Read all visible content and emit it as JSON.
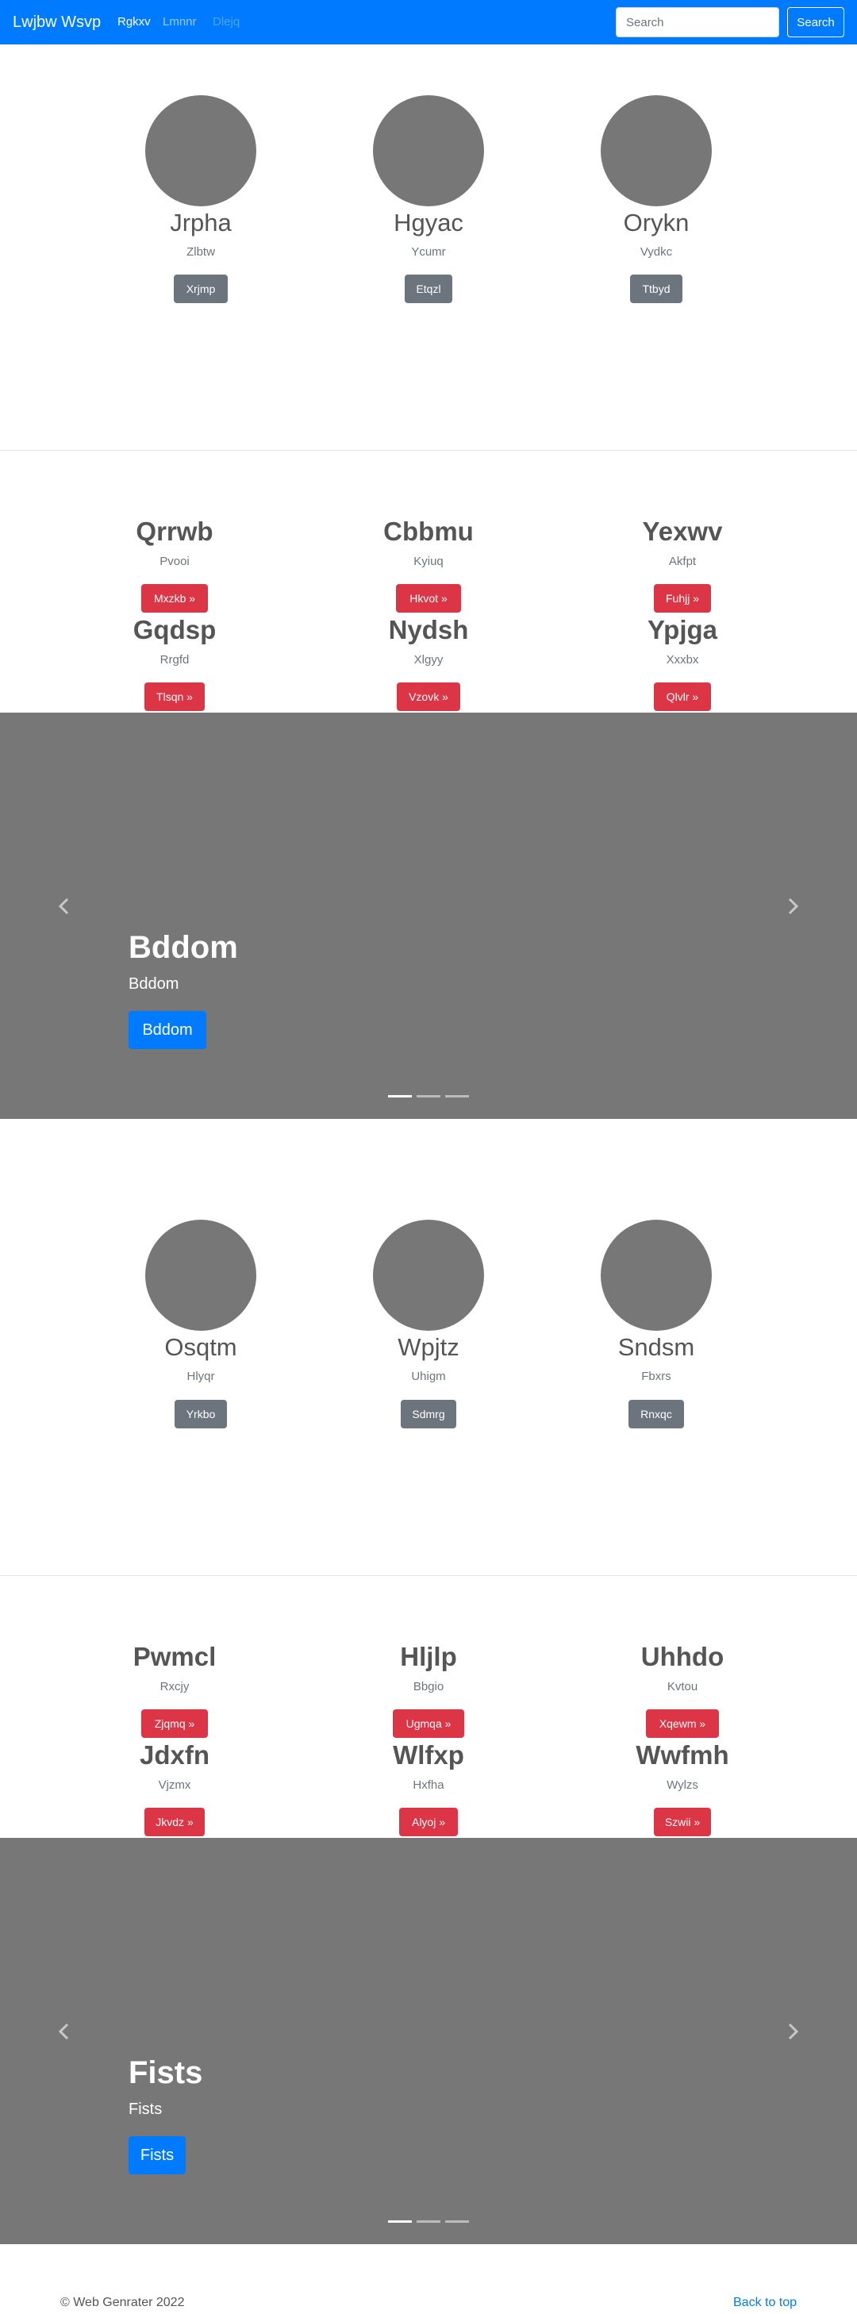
{
  "navbar": {
    "brand": "Lwjbw Wsvp",
    "links": [
      {
        "label": "Rgkxv",
        "state": "active"
      },
      {
        "label": "Lmnnr",
        "state": "normal"
      },
      {
        "label": "Dlejq",
        "state": "disabled"
      }
    ],
    "search_placeholder": "Search",
    "search_button": "Search"
  },
  "people_section_1": [
    {
      "name": "Jrpha",
      "sub": "Zlbtw",
      "button": "Xrjmp"
    },
    {
      "name": "Hgyac",
      "sub": "Ycumr",
      "button": "Etqzl"
    },
    {
      "name": "Orykn",
      "sub": "Vydkc",
      "button": "Ttbyd"
    }
  ],
  "features_section_1": [
    {
      "title": "Qrrwb",
      "sub": "Pvooi",
      "button": "Mxzkb »"
    },
    {
      "title": "Cbbmu",
      "sub": "Kyiuq",
      "button": "Hkvot »"
    },
    {
      "title": "Yexwv",
      "sub": "Akfpt",
      "button": "Fuhjj »"
    },
    {
      "title": "Gqdsp",
      "sub": "Rrgfd",
      "button": "Tlsqn »"
    },
    {
      "title": "Nydsh",
      "sub": "Xlgyy",
      "button": "Vzovk »"
    },
    {
      "title": "Ypjga",
      "sub": "Xxxbx",
      "button": "Qlvlr »"
    }
  ],
  "carousel_1": {
    "title": "Bddom",
    "sub": "Bddom",
    "button": "Bddom",
    "active_index": 0,
    "indicator_count": 3
  },
  "people_section_2": [
    {
      "name": "Osqtm",
      "sub": "Hlyqr",
      "button": "Yrkbo"
    },
    {
      "name": "Wpjtz",
      "sub": "Uhigm",
      "button": "Sdmrg"
    },
    {
      "name": "Sndsm",
      "sub": "Fbxrs",
      "button": "Rnxqc"
    }
  ],
  "features_section_2": [
    {
      "title": "Pwmcl",
      "sub": "Rxcjy",
      "button": "Zjqmq »"
    },
    {
      "title": "Hljlp",
      "sub": "Bbgio",
      "button": "Ugmqa »"
    },
    {
      "title": "Uhhdo",
      "sub": "Kvtou",
      "button": "Xqewm »"
    },
    {
      "title": "Jdxfn",
      "sub": "Vjzmx",
      "button": "Jkvdz »"
    },
    {
      "title": "Wlfxp",
      "sub": "Hxfha",
      "button": "Alyoj »"
    },
    {
      "title": "Wwfmh",
      "sub": "Wylzs",
      "button": "Szwii »"
    }
  ],
  "carousel_2": {
    "title": "Fists",
    "sub": "Fists",
    "button": "Fists",
    "active_index": 0,
    "indicator_count": 3
  },
  "footer": {
    "copyright": "© Web Genrater 2022",
    "back_to_top": "Back to top"
  },
  "colors": {
    "primary": "#007bff",
    "secondary": "#6c757d",
    "danger": "#dc3545",
    "placeholder_gray": "#777777"
  },
  "icons": {
    "prev": "chevron-left-icon",
    "next": "chevron-right-icon"
  }
}
